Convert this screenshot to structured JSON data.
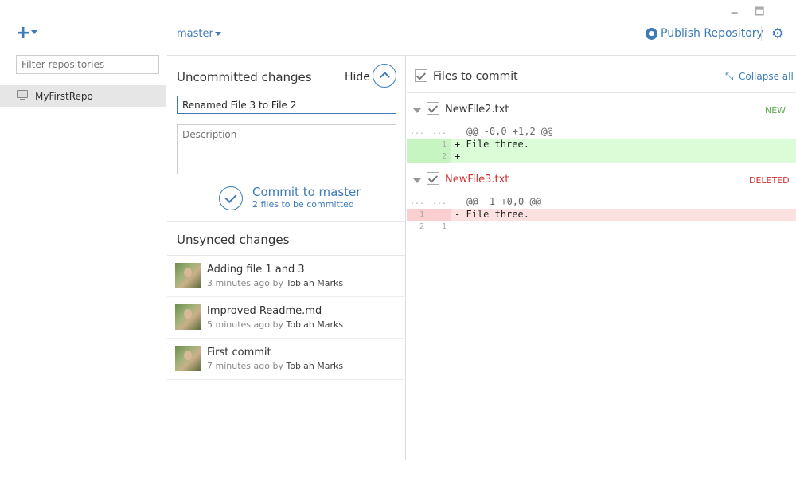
{
  "window": {
    "minimize": "🗕",
    "maximize": "🗖"
  },
  "sidebar": {
    "add_label": "+",
    "filter_placeholder": "Filter repositories",
    "repos": [
      {
        "name": "MyFirstRepo"
      }
    ]
  },
  "toolbar": {
    "branch": "master",
    "publish_label": "Publish Repository",
    "settings_icon": "⚙"
  },
  "uncommitted": {
    "title": "Uncommitted changes",
    "hide_label": "Hide",
    "summary_value": "Renamed File 3 to File 2",
    "description_placeholder": "Description",
    "commit_label": "Commit to master",
    "commit_sub": "2 files to be committed"
  },
  "unsynced": {
    "title": "Unsynced changes",
    "commits": [
      {
        "message": "Adding file 1 and 3",
        "time": "3 minutes ago by ",
        "author": "Tobiah Marks"
      },
      {
        "message": "Improved Readme.md",
        "time": "5 minutes ago by ",
        "author": "Tobiah Marks"
      },
      {
        "message": "First commit",
        "time": "7 minutes ago by ",
        "author": "Tobiah Marks"
      }
    ]
  },
  "files": {
    "header_label": "Files to commit",
    "collapse_label": "Collapse all",
    "collapse_icon": "⤡",
    "items": [
      {
        "name": "NewFile2.txt",
        "status": "NEW",
        "hunk": "@@ -0,0 +1,2 @@",
        "lines": [
          {
            "old": "...",
            "new": "...",
            "code": "@@ -0,0 +1,2 @@"
          },
          {
            "old": "",
            "new": "1",
            "code": "+ File three."
          },
          {
            "old": "",
            "new": "2",
            "code": "+"
          }
        ]
      },
      {
        "name": "NewFile3.txt",
        "status": "DELETED",
        "lines": [
          {
            "old": "...",
            "new": "...",
            "code": "@@ -1 +0,0 @@"
          },
          {
            "old": "1",
            "new": "",
            "code": "- File three."
          },
          {
            "old": "2",
            "new": "1",
            "code": ""
          }
        ]
      }
    ]
  }
}
